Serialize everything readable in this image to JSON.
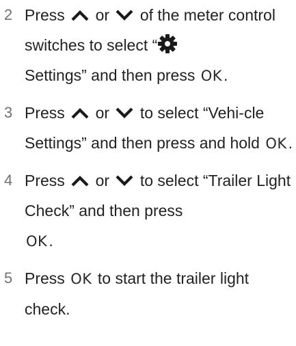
{
  "steps": [
    {
      "number": "2",
      "parts": {
        "p1": "Press",
        "p2": "or",
        "p3": "of the meter control switches to select “",
        "p4": "Settings” and then press",
        "p5": "."
      }
    },
    {
      "number": "3",
      "parts": {
        "p1": "Press",
        "p2": "or",
        "p3": "to select “Vehi-cle Settings” and then press and hold",
        "p4": "."
      }
    },
    {
      "number": "4",
      "parts": {
        "p1": "Press",
        "p2": "or",
        "p3": "to select “Trailer Light Check” and then press",
        "p4": "."
      }
    },
    {
      "number": "5",
      "parts": {
        "p1": "Press",
        "p2": "to start the trailer light check."
      }
    }
  ],
  "ok_label": "OK",
  "icons": {
    "up": "chevron-up-icon",
    "down": "chevron-down-icon",
    "settings": "gear-icon"
  },
  "colors": {
    "text": "#222222",
    "step_number": "#707070",
    "icon": "#1a1a1a"
  }
}
